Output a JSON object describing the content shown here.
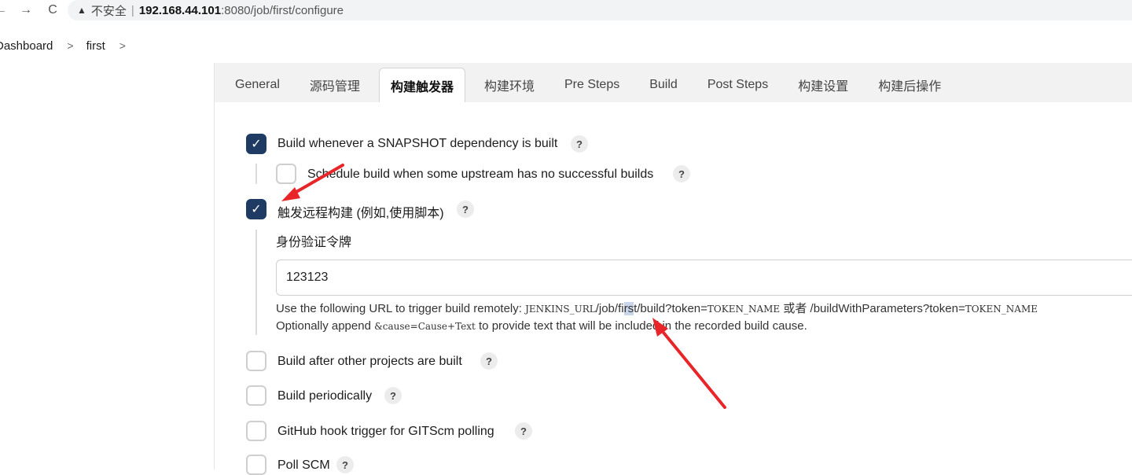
{
  "browser": {
    "back": "←",
    "forward": "→",
    "reload": "C",
    "insecure_label": "不安全",
    "separator": "|",
    "url_host": "192.168.44.101",
    "url_rest": ":8080/job/first/configure"
  },
  "breadcrumb": {
    "items": [
      "Dashboard",
      "first"
    ],
    "separator": ">"
  },
  "tabs": [
    {
      "label": "General"
    },
    {
      "label": "源码管理"
    },
    {
      "label": "构建触发器",
      "active": true
    },
    {
      "label": "构建环境"
    },
    {
      "label": "Pre Steps"
    },
    {
      "label": "Build"
    },
    {
      "label": "Post Steps"
    },
    {
      "label": "构建设置"
    },
    {
      "label": "构建后操作"
    }
  ],
  "triggers": {
    "snapshot": {
      "label": "Build whenever a SNAPSHOT dependency is built",
      "checked": true
    },
    "upstream": {
      "label": "Schedule build when some upstream has no successful builds",
      "checked": false
    },
    "remote": {
      "label": "触发远程构建 (例如,使用脚本)",
      "checked": true
    },
    "after_other": {
      "label": "Build after other projects are built",
      "checked": false
    },
    "periodically": {
      "label": "Build periodically",
      "checked": false
    },
    "github_hook": {
      "label": "GitHub hook trigger for GITScm polling",
      "checked": false
    },
    "poll_scm": {
      "label": "Poll SCM",
      "checked": false
    }
  },
  "help_symbol": "?",
  "check_symbol": "✓",
  "token": {
    "label": "身份验证令牌",
    "value": "123123"
  },
  "hint": {
    "line1_prefix": "Use the following URL to trigger build remotely: ",
    "jenkins_url": "JENKINS_URL",
    "path_a": "/job/fi",
    "path_hl": "rs",
    "path_b": "t/build?token=",
    "token_name": "TOKEN_NAME",
    "or": " 或者 ",
    "with_params": "/buildWithParameters?token=",
    "token_name2": "TOKEN_NAME",
    "line2_prefix": "Optionally append ",
    "cause_code": "&cause=Cause+Text",
    "line2_suffix": " to provide text that will be included in the recorded build cause."
  },
  "colors": {
    "checked": "#1f3b63",
    "arrow": "#e8262a",
    "tabbar": "#f2f2f2"
  }
}
